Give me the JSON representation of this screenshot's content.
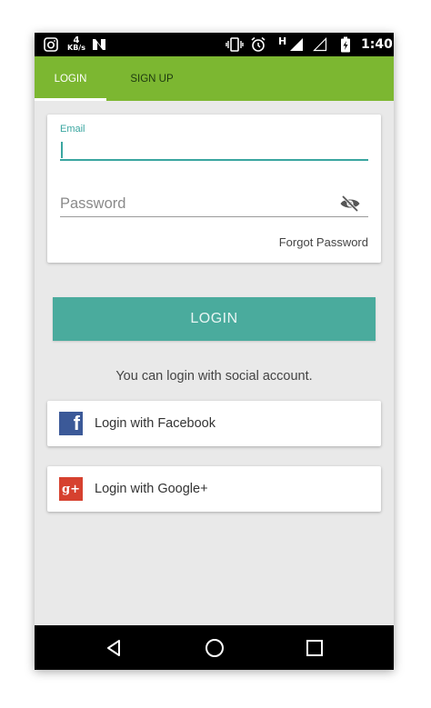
{
  "status_bar": {
    "netspeed_value": "4",
    "netspeed_unit": "KB/s",
    "network_type": "H",
    "time": "1:40",
    "icons": [
      "instagram-icon",
      "n-notification-icon",
      "vibrate-icon",
      "alarm-icon",
      "signal-icon",
      "signal-empty-icon",
      "battery-charging-icon"
    ]
  },
  "tabs": [
    {
      "label": "LOGIN",
      "active": true
    },
    {
      "label": "SIGN UP",
      "active": false
    }
  ],
  "form": {
    "email_label": "Email",
    "email_value": "",
    "password_placeholder": "Password",
    "password_icon": "eye-off-icon",
    "forgot_label": "Forgot Password"
  },
  "login_button": "LOGIN",
  "social": {
    "hint": "You can login with social account.",
    "facebook_label": "Login with Facebook",
    "facebook_icon_glyph": "f",
    "google_label": "Login with Google+",
    "google_icon_glyph": "g+"
  },
  "nav": [
    "back-icon",
    "home-icon",
    "recents-icon"
  ],
  "colors": {
    "accent_green": "#7cb731",
    "teal": "#4aab9d",
    "facebook_blue": "#3b5998",
    "google_red": "#d6412f",
    "background": "#e9e9e9"
  }
}
